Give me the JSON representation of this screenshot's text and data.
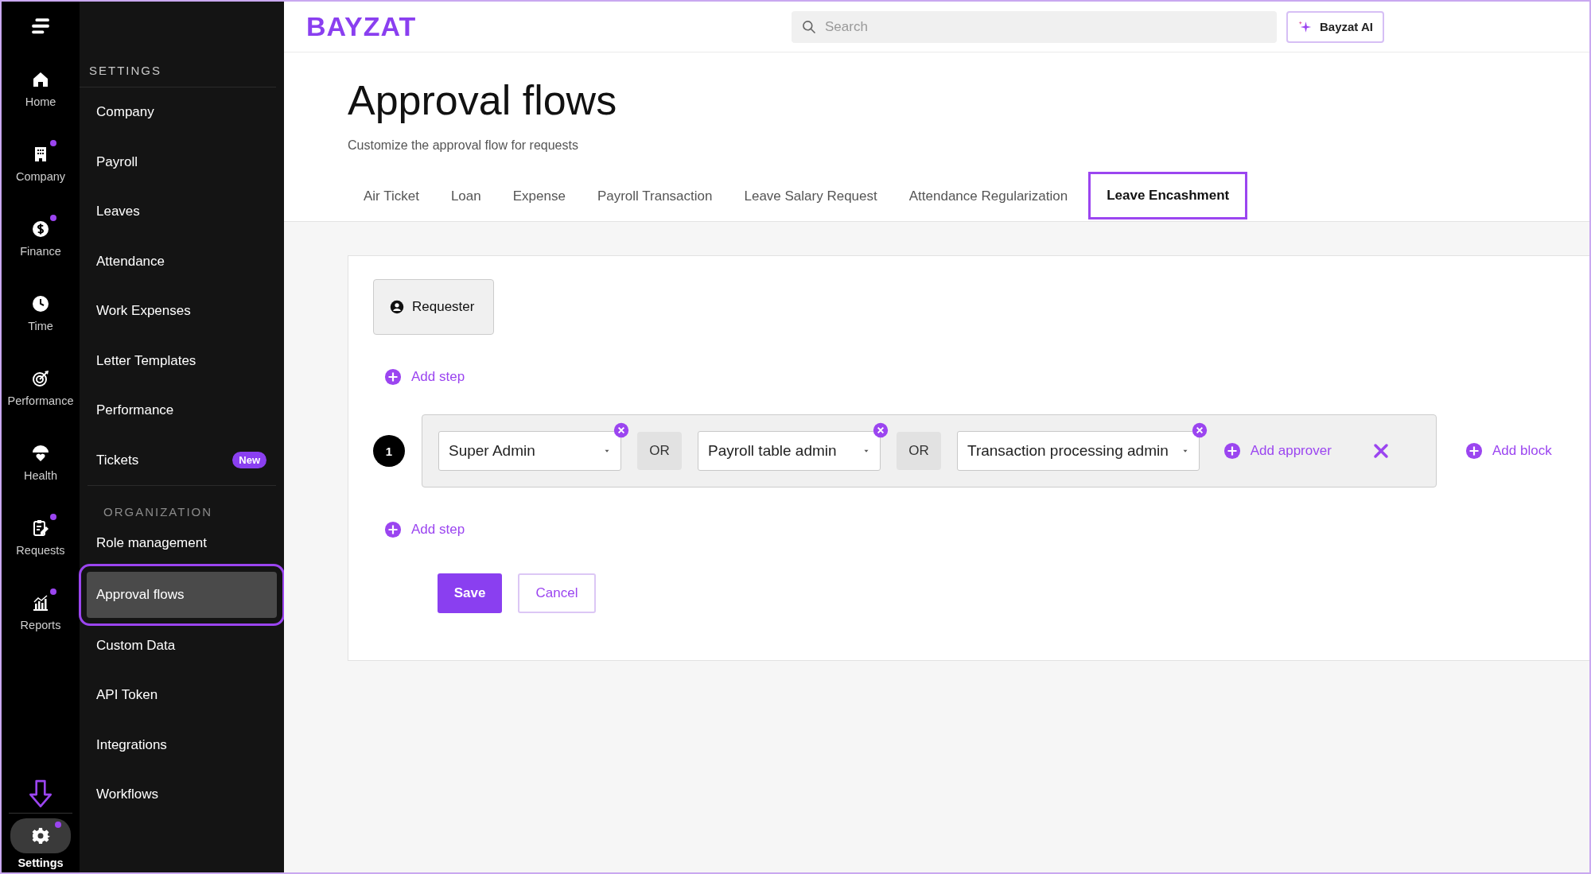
{
  "rail": {
    "items": [
      {
        "label": "Home",
        "notification": false,
        "selected": false
      },
      {
        "label": "Company",
        "notification": true,
        "selected": false
      },
      {
        "label": "Finance",
        "notification": true,
        "selected": false
      },
      {
        "label": "Time",
        "notification": false,
        "selected": false
      },
      {
        "label": "Performance",
        "notification": false,
        "selected": false
      },
      {
        "label": "Health",
        "notification": false,
        "selected": false
      },
      {
        "label": "Requests",
        "notification": true,
        "selected": false
      },
      {
        "label": "Reports",
        "notification": true,
        "selected": false
      }
    ],
    "settings": {
      "label": "Settings",
      "notification": true,
      "selected": true
    }
  },
  "settings_menu": {
    "sections": [
      {
        "heading": "SETTINGS",
        "items": [
          {
            "label": "Company",
            "selected": false
          },
          {
            "label": "Payroll",
            "selected": false
          },
          {
            "label": "Leaves",
            "selected": false
          },
          {
            "label": "Attendance",
            "selected": false
          },
          {
            "label": "Work Expenses",
            "selected": false
          },
          {
            "label": "Letter Templates",
            "selected": false
          },
          {
            "label": "Performance",
            "selected": false
          },
          {
            "label": "Tickets",
            "selected": false,
            "badge": "New"
          }
        ]
      },
      {
        "heading": "ORGANIZATION",
        "items": [
          {
            "label": "Role management",
            "selected": false
          },
          {
            "label": "Approval flows",
            "selected": true
          },
          {
            "label": "Custom Data",
            "selected": false
          },
          {
            "label": "API Token",
            "selected": false
          },
          {
            "label": "Integrations",
            "selected": false
          },
          {
            "label": "Workflows",
            "selected": false
          }
        ]
      }
    ]
  },
  "top_bar": {
    "logo": "BAYZAT",
    "search": {
      "placeholder": "Search"
    },
    "ai_button": "Bayzat AI"
  },
  "page": {
    "title": "Approval flows",
    "subtitle": "Customize the approval flow for requests"
  },
  "tabs": [
    {
      "label": "Air Ticket",
      "selected": false
    },
    {
      "label": "Loan",
      "selected": false
    },
    {
      "label": "Expense",
      "selected": false
    },
    {
      "label": "Payroll Transaction",
      "selected": false
    },
    {
      "label": "Leave Salary Request",
      "selected": false
    },
    {
      "label": "Attendance Regularization",
      "selected": false
    },
    {
      "label": "Leave Encashment",
      "selected": true
    }
  ],
  "flow": {
    "requester": "Requester",
    "add_step_top": "Add step",
    "steps": [
      {
        "number": "1",
        "approvers": [
          {
            "value": "Super Admin",
            "connector": "OR"
          },
          {
            "value": "Payroll table admin",
            "connector": "OR"
          },
          {
            "value": "Transaction processing admin"
          }
        ],
        "add_approver": "Add approver",
        "add_block": "Add block"
      }
    ],
    "add_step_bottom": "Add step"
  },
  "buttons": {
    "save": "Save",
    "cancel": "Cancel"
  }
}
